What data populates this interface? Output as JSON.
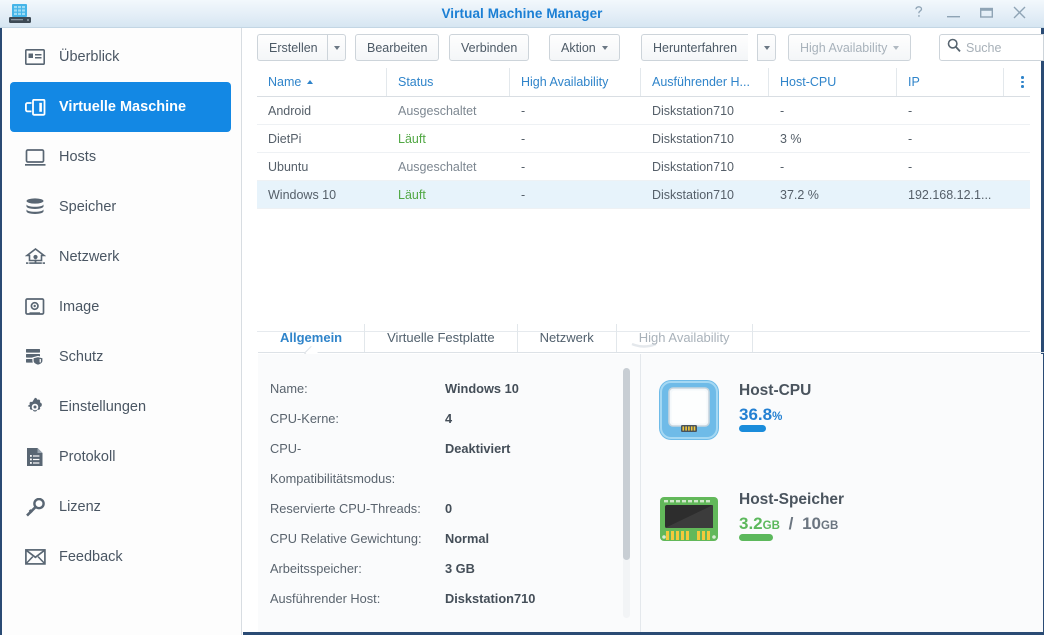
{
  "window": {
    "title": "Virtual Machine Manager",
    "app_icon": "synology-nas-icon",
    "controls": {
      "help": "?",
      "minimize": "–",
      "maximize": "▭",
      "close": "✕"
    }
  },
  "colors": {
    "accent_blue": "#1388e4",
    "title_blue": "#1b7fd4",
    "header_link": "#2f84ca",
    "running_green": "#52a845",
    "cpu_bar": "#1a8cdb",
    "mem_bar": "#5cb85c",
    "sidebar_rail": "#2a4b74",
    "row_selected": "#e7f3fb"
  },
  "sidebar": {
    "items": [
      {
        "label": "Überblick",
        "icon": "overview-card-icon",
        "active": false
      },
      {
        "label": "Virtuelle Maschine",
        "icon": "virtual-machine-icon",
        "active": true
      },
      {
        "label": "Hosts",
        "icon": "monitor-icon",
        "active": false
      },
      {
        "label": "Speicher",
        "icon": "database-stack-icon",
        "active": false
      },
      {
        "label": "Netzwerk",
        "icon": "network-node-icon",
        "active": false
      },
      {
        "label": "Image",
        "icon": "disc-image-icon",
        "active": false
      },
      {
        "label": "Schutz",
        "icon": "shield-server-icon",
        "active": false
      },
      {
        "label": "Einstellungen",
        "icon": "gear-icon",
        "active": false
      },
      {
        "label": "Protokoll",
        "icon": "log-document-icon",
        "active": false
      },
      {
        "label": "Lizenz",
        "icon": "key-icon",
        "active": false
      },
      {
        "label": "Feedback",
        "icon": "envelope-icon",
        "active": false
      }
    ]
  },
  "toolbar": {
    "create": "Erstellen",
    "edit": "Bearbeiten",
    "connect": "Verbinden",
    "action": "Aktion",
    "shutdown": "Herunterfahren",
    "high_availability": "High Availability",
    "search_placeholder": "Suche",
    "search_value": "",
    "search_icon": "search-icon"
  },
  "table": {
    "columns": [
      {
        "label": "Name",
        "sorted": "asc",
        "width": 130
      },
      {
        "label": "Status",
        "width": 123
      },
      {
        "label": "High Availability",
        "width": 131
      },
      {
        "label": "Ausführender H...",
        "width": 128
      },
      {
        "label": "Host-CPU",
        "width": 128
      },
      {
        "label": "IP",
        "width": 107
      }
    ],
    "column_menu_icon": "column-options-icon",
    "rows": [
      {
        "name": "Android",
        "status": "Ausgeschaltet",
        "status_state": "off",
        "ha": "-",
        "host": "Diskstation710",
        "cpu": "-",
        "ip": "-",
        "selected": false
      },
      {
        "name": "DietPi",
        "status": "Läuft",
        "status_state": "running",
        "ha": "-",
        "host": "Diskstation710",
        "cpu": "3 %",
        "ip": "-",
        "selected": false
      },
      {
        "name": "Ubuntu",
        "status": "Ausgeschaltet",
        "status_state": "off",
        "ha": "-",
        "host": "Diskstation710",
        "cpu": "-",
        "ip": "-",
        "selected": false
      },
      {
        "name": "Windows 10",
        "status": "Läuft",
        "status_state": "running",
        "ha": "-",
        "host": "Diskstation710",
        "cpu": "37.2 %",
        "ip": "192.168.12.1...",
        "selected": true
      }
    ]
  },
  "detail": {
    "tabs": [
      {
        "label": "Allgemein",
        "state": "active"
      },
      {
        "label": "Virtuelle Festplatte",
        "state": "normal"
      },
      {
        "label": "Netzwerk",
        "state": "normal"
      },
      {
        "label": "High Availability",
        "state": "disabled"
      }
    ],
    "properties": [
      {
        "key": "Name:",
        "value": "Windows 10"
      },
      {
        "key": "CPU-Kerne:",
        "value": "4"
      },
      {
        "key": "CPU-",
        "value": "Deaktiviert"
      },
      {
        "key": "Kompatibilitätsmodus:",
        "value": ""
      },
      {
        "key": "Reservierte CPU-Threads:",
        "value": "0"
      },
      {
        "key": "CPU Relative Gewichtung:",
        "value": "Normal"
      },
      {
        "key": "Arbeitsspeicher:",
        "value": "3 GB"
      },
      {
        "key": "Ausführender Host:",
        "value": "Diskstation710"
      }
    ],
    "gauges": [
      {
        "title": "Host-CPU",
        "icon": "cpu-chip-icon",
        "value": "36.8",
        "unit": "%",
        "percent": 36.8,
        "color": "#1a8cdb"
      },
      {
        "title": "Host-Speicher",
        "icon": "memory-module-icon",
        "used": "3.2",
        "used_unit": "GB",
        "separator": "/",
        "total": "10",
        "total_unit": "GB",
        "percent": 32,
        "color": "#5cb85c"
      }
    ]
  }
}
